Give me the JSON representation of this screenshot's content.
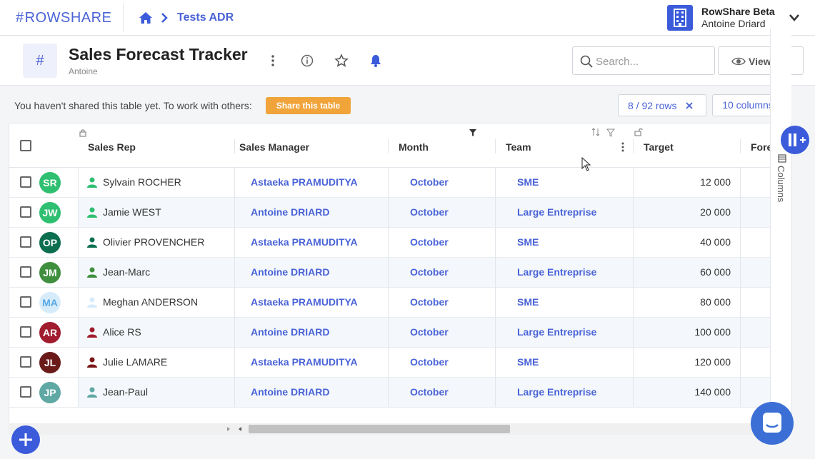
{
  "app": {
    "logo": "ROWSHARE",
    "logo_hash": "#",
    "breadcrumb": "Tests ADR",
    "workspace_title": "RowShare Beta",
    "workspace_user": "Antoine Driard"
  },
  "table": {
    "title": "Sales Forecast Tracker",
    "owner": "Antoine",
    "icon": "#",
    "search_placeholder": "Search...",
    "views_label": "Views"
  },
  "share": {
    "message": "You haven't shared this table yet. To work with others:",
    "button": "Share this table",
    "rows_chip": "8 / 92 rows",
    "columns_chip": "10 columns"
  },
  "columns": {
    "rep": "Sales Rep",
    "manager": "Sales Manager",
    "month": "Month",
    "team": "Team",
    "target": "Target",
    "forecast": "Fore"
  },
  "side_panel_label": "Columns",
  "rows": [
    {
      "initials": "SR",
      "color": "#2fbf71",
      "person_color": "#2fbf71",
      "rep": "Sylvain ROCHER",
      "manager": "Astaeka PRAMUDITYA",
      "month": "October",
      "team": "SME",
      "target": "12 000"
    },
    {
      "initials": "JW",
      "color": "#2fbf71",
      "person_color": "#2fbf71",
      "rep": "Jamie WEST",
      "manager": "Antoine DRIARD",
      "month": "October",
      "team": "Large Entreprise",
      "target": "20 000"
    },
    {
      "initials": "OP",
      "color": "#0b6e4f",
      "person_color": "#0b6e4f",
      "rep": "Olivier PROVENCHER",
      "manager": "Astaeka PRAMUDITYA",
      "month": "October",
      "team": "SME",
      "target": "40 000"
    },
    {
      "initials": "JM",
      "color": "#3f8f3f",
      "person_color": "#3f8f3f",
      "rep": "Jean-Marc",
      "manager": "Antoine DRIARD",
      "month": "October",
      "team": "Large Entreprise",
      "target": "60 000"
    },
    {
      "initials": "MA",
      "color": "#d7ecfb",
      "person_color": "#d7ecfb",
      "text_color": "#5aa9e6",
      "rep": "Meghan ANDERSON",
      "manager": "Astaeka PRAMUDITYA",
      "month": "October",
      "team": "SME",
      "target": "80 000"
    },
    {
      "initials": "AR",
      "color": "#a01c2e",
      "person_color": "#a01c2e",
      "rep": "Alice RS",
      "manager": "Antoine DRIARD",
      "month": "October",
      "team": "Large Entreprise",
      "target": "100 000"
    },
    {
      "initials": "JL",
      "color": "#6b1a1a",
      "person_color": "#7a1515",
      "rep": "Julie LAMARE",
      "manager": "Astaeka PRAMUDITYA",
      "month": "October",
      "team": "SME",
      "target": "120 000"
    },
    {
      "initials": "JP",
      "color": "#5fa8a4",
      "person_color": "#5fa8a4",
      "rep": "Jean-Paul",
      "manager": "Antoine DRIARD",
      "month": "October",
      "team": "Large Entreprise",
      "target": "140 000"
    }
  ]
}
